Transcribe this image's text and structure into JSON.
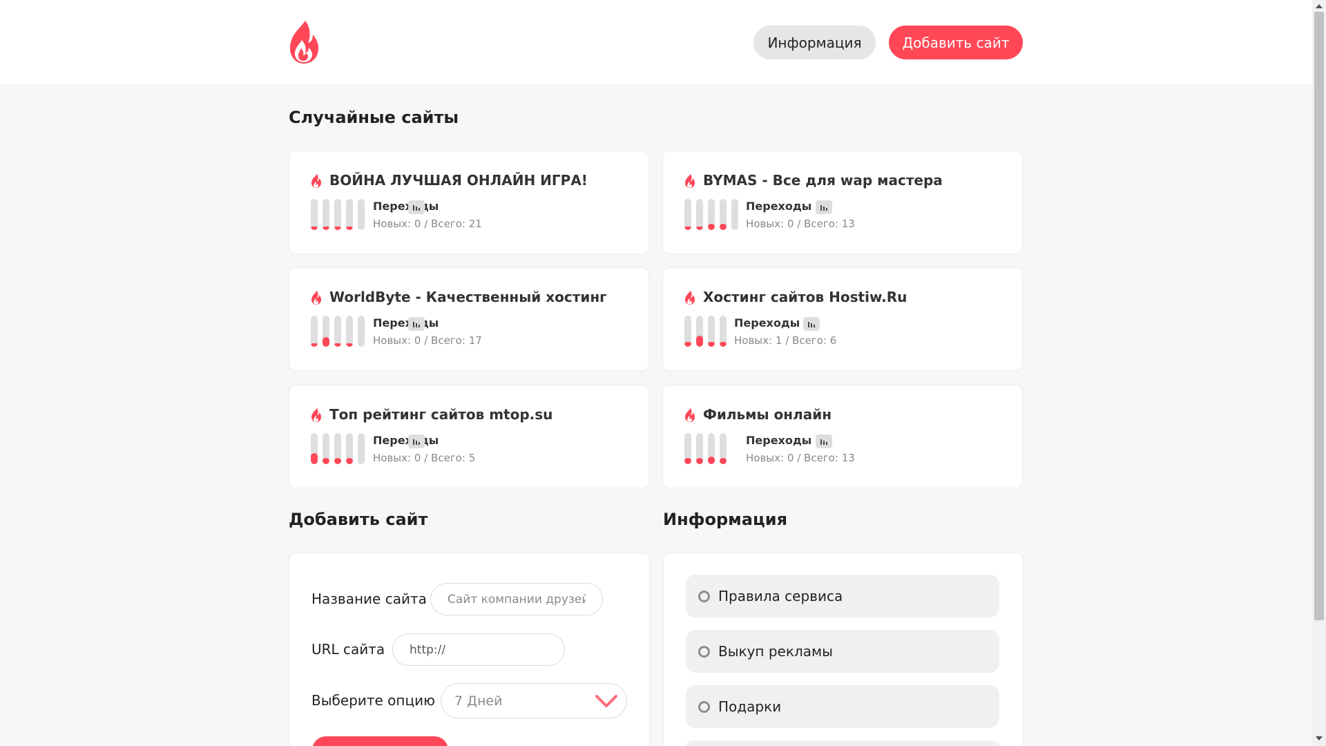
{
  "header": {
    "logo_icon": "flame-logo-icon",
    "info_button": "Информация",
    "add_button": "Добавить сайт",
    "accent_color": "#ff4757"
  },
  "random_sites": {
    "title": "Случайные сайты",
    "stats_label": "Переходы",
    "cards": [
      {
        "name": "ВОЙНА ЛУЧШАЯ ОНЛАЙН ИГРА!",
        "new_label": "Новых:",
        "new": "0",
        "sep": "/",
        "total_label": "Всего:",
        "total": "21",
        "levels": [
          0.05,
          0.05,
          0.05,
          0.05,
          0
        ]
      },
      {
        "name": "BYMAS - Все для wap мастера",
        "new_label": "Новых:",
        "new": "0",
        "sep": "/",
        "total_label": "Всего:",
        "total": "13",
        "levels": [
          0.05,
          0.05,
          0.2,
          0.2,
          0
        ]
      },
      {
        "name": "WorldByte - Качественный хостинг",
        "new_label": "Новых:",
        "new": "0",
        "sep": "/",
        "total_label": "Всего:",
        "total": "17",
        "levels": [
          0.05,
          0.3,
          0.05,
          0.05,
          0
        ]
      },
      {
        "name": "Хостинг сайтов Hostiw.Ru",
        "new_label": "Новых:",
        "new": "1",
        "sep": "/",
        "total_label": "Всего:",
        "total": "6",
        "levels": [
          0.15,
          0.35,
          0.15,
          0.15
        ]
      },
      {
        "name": "Топ рейтинг сайтов mtop.su",
        "new_label": "Новых:",
        "new": "0",
        "sep": "/",
        "total_label": "Всего:",
        "total": "5",
        "levels": [
          0.35,
          0.2,
          0.2,
          0.2,
          0
        ]
      },
      {
        "name": "Фильмы онлайн",
        "new_label": "Новых:",
        "new": "0",
        "sep": "/",
        "total_label": "Всего:",
        "total": "13",
        "levels": [
          0.2,
          0.2,
          0.25,
          0.2
        ]
      }
    ]
  },
  "add_site": {
    "title": "Добавить сайт",
    "name_label": "Название сайта",
    "name_placeholder": "Сайт компании друзей",
    "url_label": "URL сайта",
    "url_value": "http://",
    "option_label": "Выберите опцию",
    "option_selected": "7 Дней"
  },
  "info": {
    "title": "Информация",
    "items": [
      "Правила сервиса",
      "Выкуп рекламы",
      "Подарки"
    ]
  }
}
